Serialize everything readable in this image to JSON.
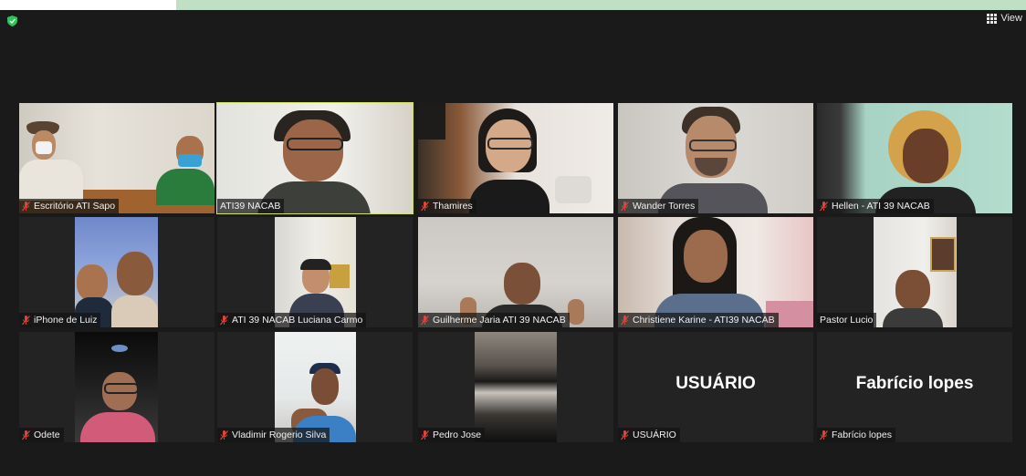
{
  "window": {
    "view_label": "View"
  },
  "colors": {
    "active_border": "#cfe25a",
    "muted_mic": "#e0443a"
  },
  "participants": [
    {
      "name": "Escritório ATI Sapo",
      "muted": true
    },
    {
      "name": "ATI39 NACAB",
      "muted": false,
      "active_speaker": true
    },
    {
      "name": "Thamires",
      "muted": true
    },
    {
      "name": "Wander Torres",
      "muted": true
    },
    {
      "name": "Hellen - ATI 39 NACAB",
      "muted": true
    },
    {
      "name": "iPhone de Luiz",
      "muted": true
    },
    {
      "name": "ATI 39 NACAB Luciana Carmo",
      "muted": true
    },
    {
      "name": "Guilherme Jaria ATI 39 NACAB",
      "muted": true
    },
    {
      "name": "Christiene Karine - ATI39 NACAB",
      "muted": true
    },
    {
      "name": "Pastor Lucio",
      "muted": false
    },
    {
      "name": "Odete",
      "muted": true
    },
    {
      "name": "Vladimir Rogerio Silva",
      "muted": true
    },
    {
      "name": "Pedro Jose",
      "muted": true
    },
    {
      "name": "USUÁRIO",
      "muted": true,
      "display_name": "USUÁRIO"
    },
    {
      "name": "Fabrício lopes",
      "muted": true,
      "display_name": "Fabrício lopes"
    }
  ]
}
